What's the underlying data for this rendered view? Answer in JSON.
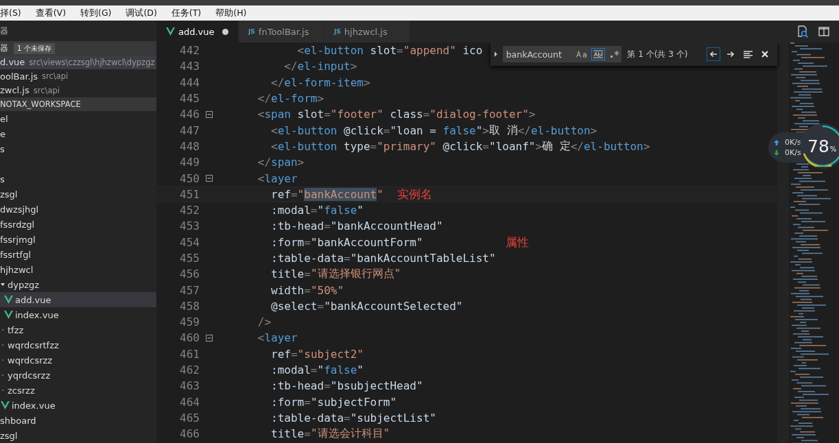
{
  "menu": [
    "择(S)",
    "查看(V)",
    "转到(G)",
    "调试(D)",
    "任务(T)",
    "帮助(H)"
  ],
  "sidebar": {
    "title": "器",
    "open_editors": {
      "label": "器",
      "badge": "1 个未保存",
      "items": [
        {
          "name": "d.vue",
          "path": "src\\views\\czzsgl\\hjhzwcl\\dypzgz",
          "selected": true
        },
        {
          "name": "oolBar.js",
          "path": "src\\api",
          "selected": false
        },
        {
          "name": "zwcl.js",
          "path": "src\\api",
          "selected": false
        }
      ]
    },
    "workspace": "NOTAX_WORKSPACE",
    "tree": [
      {
        "name": "el",
        "selected": false
      },
      {
        "name": "e",
        "selected": false
      },
      {
        "name": "s",
        "selected": false
      },
      {
        "name": "s",
        "selected": false
      },
      {
        "name": "zsgl",
        "selected": false
      },
      {
        "name": "dwzsjhgl",
        "selected": false
      },
      {
        "name": "fssrdzgl",
        "selected": false
      },
      {
        "name": "fssrjmgl",
        "selected": false
      },
      {
        "name": "fssrtfgl",
        "selected": false
      },
      {
        "name": "hjhzwcl",
        "selected": false,
        "children": [
          {
            "name": "dypzgz",
            "expanded": true,
            "selected": false,
            "children": [
              {
                "name": "add.vue",
                "kind": "vue",
                "selected": true
              },
              {
                "name": "index.vue",
                "kind": "vue",
                "selected": false
              }
            ]
          },
          {
            "name": "tfzz",
            "expanded": false,
            "selected": false
          },
          {
            "name": "wqrdcsrtfzz",
            "expanded": false,
            "selected": false
          },
          {
            "name": "wqrdcsrzz",
            "expanded": false,
            "selected": false
          },
          {
            "name": "yqrdcsrzz",
            "expanded": false,
            "selected": false
          },
          {
            "name": "zcsrzz",
            "expanded": false,
            "selected": false
          },
          {
            "name": "index.vue",
            "kind": "vue",
            "selected": false
          }
        ]
      },
      {
        "name": "shboard",
        "selected": false
      },
      {
        "name": "zsgl",
        "selected": false
      }
    ]
  },
  "tabs": [
    {
      "label": "add.vue",
      "kind": "vue",
      "selected": true,
      "dirty": true
    },
    {
      "label": "fnToolBar.js",
      "kind": "js",
      "icon_text": "JS",
      "selected": false,
      "dirty": false
    },
    {
      "label": "hjhzwcl.js",
      "kind": "js",
      "icon_text": "JS",
      "selected": false,
      "dirty": false
    }
  ],
  "find": {
    "value": "bankAccount",
    "match_case": false,
    "whole_word": true,
    "regex": false,
    "result": "第 1 个(共 3 个)"
  },
  "code": [
    {
      "n": "442",
      "fold": false,
      "current": false,
      "tokens": [
        {
          "kind": "punct",
          "text": "            <"
        },
        {
          "kind": "tag",
          "text": "el-button"
        },
        {
          "kind": "attr",
          "text": " slot"
        },
        {
          "kind": "punct",
          "text": "="
        },
        {
          "kind": "str",
          "text": "\"append\""
        },
        {
          "kind": "attr",
          "text": " ico"
        }
      ]
    },
    {
      "n": "443",
      "fold": false,
      "current": false,
      "tokens": [
        {
          "kind": "punct",
          "text": "          </"
        },
        {
          "kind": "tag",
          "text": "el-input"
        },
        {
          "kind": "punct",
          "text": ">"
        }
      ]
    },
    {
      "n": "444",
      "fold": false,
      "current": false,
      "tokens": [
        {
          "kind": "punct",
          "text": "        </"
        },
        {
          "kind": "tag",
          "text": "el-form-item"
        },
        {
          "kind": "punct",
          "text": ">"
        }
      ]
    },
    {
      "n": "445",
      "fold": false,
      "current": false,
      "tokens": [
        {
          "kind": "punct",
          "text": "      </"
        },
        {
          "kind": "tag",
          "text": "el-form"
        },
        {
          "kind": "punct",
          "text": ">"
        }
      ]
    },
    {
      "n": "446",
      "fold": true,
      "current": false,
      "tokens": [
        {
          "kind": "punct",
          "text": "      <"
        },
        {
          "kind": "tag",
          "text": "span"
        },
        {
          "kind": "attr",
          "text": " slot"
        },
        {
          "kind": "punct",
          "text": "="
        },
        {
          "kind": "str",
          "text": "\"footer\""
        },
        {
          "kind": "attr",
          "text": " class"
        },
        {
          "kind": "punct",
          "text": "="
        },
        {
          "kind": "str",
          "text": "\"dialog-footer\""
        },
        {
          "kind": "punct",
          "text": ">"
        }
      ]
    },
    {
      "n": "447",
      "fold": false,
      "current": false,
      "tokens": [
        {
          "kind": "punct",
          "text": "        <"
        },
        {
          "kind": "tag",
          "text": "el-button"
        },
        {
          "kind": "attr",
          "text": " @click"
        },
        {
          "kind": "punct",
          "text": "="
        },
        {
          "kind": "attr",
          "text": "\"loan = "
        },
        {
          "kind": "keyword",
          "text": "false"
        },
        {
          "kind": "attr",
          "text": "\""
        },
        {
          "kind": "punct",
          "text": ">"
        },
        {
          "kind": "text",
          "text": "取 消"
        },
        {
          "kind": "punct",
          "text": "</"
        },
        {
          "kind": "tag",
          "text": "el-button"
        },
        {
          "kind": "punct",
          "text": ">"
        }
      ]
    },
    {
      "n": "448",
      "fold": false,
      "current": false,
      "tokens": [
        {
          "kind": "punct",
          "text": "        <"
        },
        {
          "kind": "tag",
          "text": "el-button"
        },
        {
          "kind": "attr",
          "text": " type"
        },
        {
          "kind": "punct",
          "text": "="
        },
        {
          "kind": "str",
          "text": "\"primary\""
        },
        {
          "kind": "attr",
          "text": " @click"
        },
        {
          "kind": "punct",
          "text": "="
        },
        {
          "kind": "attr",
          "text": "\"loanf\""
        },
        {
          "kind": "punct",
          "text": ">"
        },
        {
          "kind": "text",
          "text": "确 定"
        },
        {
          "kind": "punct",
          "text": "</"
        },
        {
          "kind": "tag",
          "text": "el-button"
        },
        {
          "kind": "punct",
          "text": ">"
        }
      ]
    },
    {
      "n": "449",
      "fold": false,
      "current": false,
      "tokens": [
        {
          "kind": "punct",
          "text": "      </"
        },
        {
          "kind": "tag",
          "text": "span"
        },
        {
          "kind": "punct",
          "text": ">"
        }
      ]
    },
    {
      "n": "450",
      "fold": true,
      "current": false,
      "tokens": [
        {
          "kind": "punct",
          "text": "      <"
        },
        {
          "kind": "tag",
          "text": "layer"
        }
      ]
    },
    {
      "n": "451",
      "fold": false,
      "current": true,
      "tokens": [
        {
          "kind": "attr",
          "text": "        ref"
        },
        {
          "kind": "punct",
          "text": "="
        },
        {
          "kind": "str",
          "text": "\""
        },
        {
          "kind": "match",
          "text": "bankAccount"
        },
        {
          "kind": "str",
          "text": "\""
        },
        {
          "kind": "note",
          "text": "实例名"
        }
      ]
    },
    {
      "n": "452",
      "fold": false,
      "current": false,
      "tokens": [
        {
          "kind": "attr",
          "text": "        :modal"
        },
        {
          "kind": "punct",
          "text": "="
        },
        {
          "kind": "attr",
          "text": "\""
        },
        {
          "kind": "keyword",
          "text": "false"
        },
        {
          "kind": "attr",
          "text": "\""
        }
      ]
    },
    {
      "n": "453",
      "fold": false,
      "current": false,
      "tokens": [
        {
          "kind": "attr",
          "text": "        :tb-head"
        },
        {
          "kind": "punct",
          "text": "="
        },
        {
          "kind": "attr",
          "text": "\"bankAccountHead\""
        }
      ]
    },
    {
      "n": "454",
      "fold": false,
      "current": false,
      "tokens": [
        {
          "kind": "attr",
          "text": "        :form"
        },
        {
          "kind": "punct",
          "text": "="
        },
        {
          "kind": "attr",
          "text": "\"bankAccountForm\""
        },
        {
          "kind": "far_note",
          "text": "属性"
        }
      ]
    },
    {
      "n": "455",
      "fold": false,
      "current": false,
      "tokens": [
        {
          "kind": "attr",
          "text": "        :table-data"
        },
        {
          "kind": "punct",
          "text": "="
        },
        {
          "kind": "attr",
          "text": "\"bankAccountTableList\""
        }
      ]
    },
    {
      "n": "456",
      "fold": false,
      "current": false,
      "tokens": [
        {
          "kind": "attr",
          "text": "        title"
        },
        {
          "kind": "punct",
          "text": "="
        },
        {
          "kind": "str",
          "text": "\"请选择银行网点\""
        }
      ]
    },
    {
      "n": "457",
      "fold": false,
      "current": false,
      "tokens": [
        {
          "kind": "attr",
          "text": "        width"
        },
        {
          "kind": "punct",
          "text": "="
        },
        {
          "kind": "str",
          "text": "\"50%\""
        }
      ]
    },
    {
      "n": "458",
      "fold": false,
      "current": false,
      "tokens": [
        {
          "kind": "attr",
          "text": "        @select"
        },
        {
          "kind": "punct",
          "text": "="
        },
        {
          "kind": "attr",
          "text": "\"bankAccountSelected\""
        }
      ]
    },
    {
      "n": "459",
      "fold": false,
      "current": false,
      "tokens": [
        {
          "kind": "punct",
          "text": "      />"
        }
      ]
    },
    {
      "n": "460",
      "fold": true,
      "current": false,
      "tokens": [
        {
          "kind": "punct",
          "text": "      <"
        },
        {
          "kind": "tag",
          "text": "layer"
        }
      ]
    },
    {
      "n": "461",
      "fold": false,
      "current": false,
      "tokens": [
        {
          "kind": "attr",
          "text": "        ref"
        },
        {
          "kind": "punct",
          "text": "="
        },
        {
          "kind": "str",
          "text": "\"subject2\""
        }
      ]
    },
    {
      "n": "462",
      "fold": false,
      "current": false,
      "tokens": [
        {
          "kind": "attr",
          "text": "        :modal"
        },
        {
          "kind": "punct",
          "text": "="
        },
        {
          "kind": "attr",
          "text": "\""
        },
        {
          "kind": "keyword",
          "text": "false"
        },
        {
          "kind": "attr",
          "text": "\""
        }
      ]
    },
    {
      "n": "463",
      "fold": false,
      "current": false,
      "tokens": [
        {
          "kind": "attr",
          "text": "        :tb-head"
        },
        {
          "kind": "punct",
          "text": "="
        },
        {
          "kind": "attr",
          "text": "\"bsubjectHead\""
        }
      ]
    },
    {
      "n": "464",
      "fold": false,
      "current": false,
      "tokens": [
        {
          "kind": "attr",
          "text": "        :form"
        },
        {
          "kind": "punct",
          "text": "="
        },
        {
          "kind": "attr",
          "text": "\"subjectForm\""
        }
      ]
    },
    {
      "n": "465",
      "fold": false,
      "current": false,
      "tokens": [
        {
          "kind": "attr",
          "text": "        :table-data"
        },
        {
          "kind": "punct",
          "text": "="
        },
        {
          "kind": "attr",
          "text": "\"subjectList\""
        }
      ]
    },
    {
      "n": "466",
      "fold": false,
      "current": false,
      "tokens": [
        {
          "kind": "attr",
          "text": "        title"
        },
        {
          "kind": "punct",
          "text": "="
        },
        {
          "kind": "str",
          "text": "\"请选会计科目\""
        }
      ]
    }
  ],
  "meter": {
    "up": "0K/s",
    "down": "0K/s",
    "value": "78",
    "unit": "%"
  }
}
